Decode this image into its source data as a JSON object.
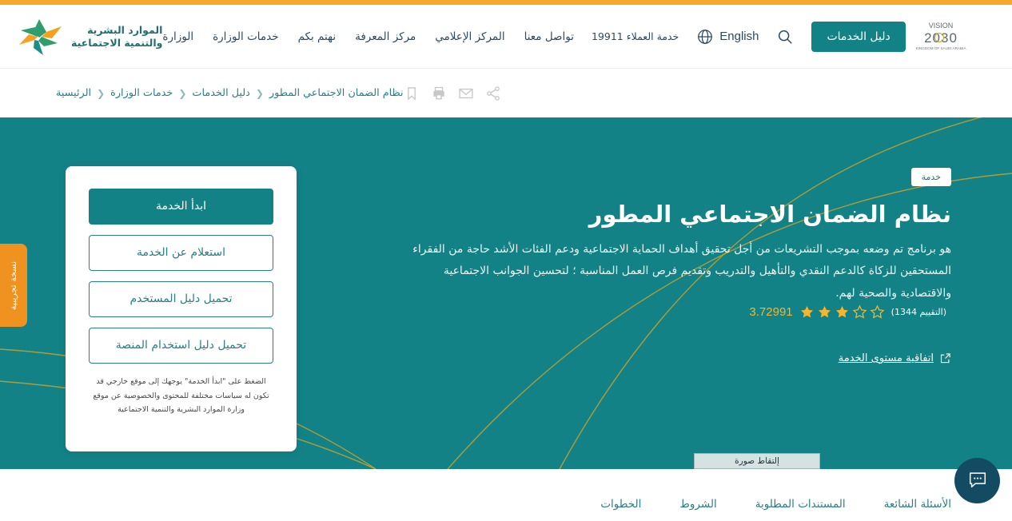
{
  "header": {
    "brand": {
      "line1": "الموارد البشرية",
      "line2": "والتنمية الاجتماعية",
      "logo_icon": "hrsd-logo-icon"
    },
    "nav": [
      {
        "label": "الوزارة"
      },
      {
        "label": "خدمات الوزارة"
      },
      {
        "label": "نهتم بكم"
      },
      {
        "label": "مركز المعرفة"
      },
      {
        "label": "المركز الإعلامي"
      },
      {
        "label": "تواصل معنا"
      }
    ],
    "customer_service": "خدمة العملاء 19911",
    "language_label": "English",
    "language_icon": "globe-icon",
    "search_icon": "search-icon",
    "guide_button": "دليل الخدمات",
    "vision_logo": "vision-2030-logo"
  },
  "breadcrumb": {
    "separator": "❮",
    "items": [
      {
        "label": "الرئيسية"
      },
      {
        "label": "خدمات الوزارة"
      },
      {
        "label": "دليل الخدمات"
      },
      {
        "label": "نظام الضمان الاجتماعي المطور"
      }
    ],
    "tools": [
      {
        "name": "share-icon"
      },
      {
        "name": "email-icon"
      },
      {
        "name": "print-icon"
      },
      {
        "name": "bookmark-icon"
      }
    ]
  },
  "hero": {
    "badge": "خدمة",
    "title": "نظام الضمان الاجتماعي المطور",
    "description": "هو برنامج تم وضعه بموجب التشريعات من أجل تحقيق أهداف الحماية الاجتماعية ودعم الفئات الأشد حاجة من الفقراء المستحقين للزكاة كالدعم النقدي والتأهيل والتدريب وتقديم فرص العمل المناسبة ؛ لتحسين الجوانب الاجتماعية والاقتصادية والصحية لهم.",
    "rating": {
      "value": "3.72991",
      "count_label": "(التقييم 1344)",
      "filled_stars": 3,
      "total_stars": 5
    },
    "sla": {
      "label": "اتفاقية مستوى الخدمة",
      "icon": "external-link-icon"
    }
  },
  "card": {
    "buttons": [
      {
        "label": "ابدأ الخدمة",
        "style": "primary"
      },
      {
        "label": "استعلام عن الخدمة",
        "style": "ghost"
      },
      {
        "label": "تحميل دليل المستخدم",
        "style": "ghost"
      },
      {
        "label": "تحميل دليل استخدام المنصة",
        "style": "ghost"
      }
    ],
    "note": "الضغط على \"ابدأ الخدمة\" يوجهك إلى موقع خارجي قد تكون له سياسات مختلفة للمحتوى والخصوصية عن موقع وزارة الموارد البشرية والتنمية الاجتماعية"
  },
  "beta_tab": {
    "label": "نسخة تجريبية"
  },
  "capture_chip": {
    "label": "إلتقاط صورة"
  },
  "chat": {
    "icon": "chat-bubble-icon"
  },
  "bottom_tabs": [
    {
      "label": "الخطوات"
    },
    {
      "label": "الشروط"
    },
    {
      "label": "المستندات المطلوبة"
    },
    {
      "label": "الأسئلة الشائعة"
    }
  ],
  "colors": {
    "teal": "#138287",
    "amber": "#f4a92a",
    "orange": "#f0921f",
    "navy": "#134b63",
    "gold_line": "#c8a22a"
  }
}
